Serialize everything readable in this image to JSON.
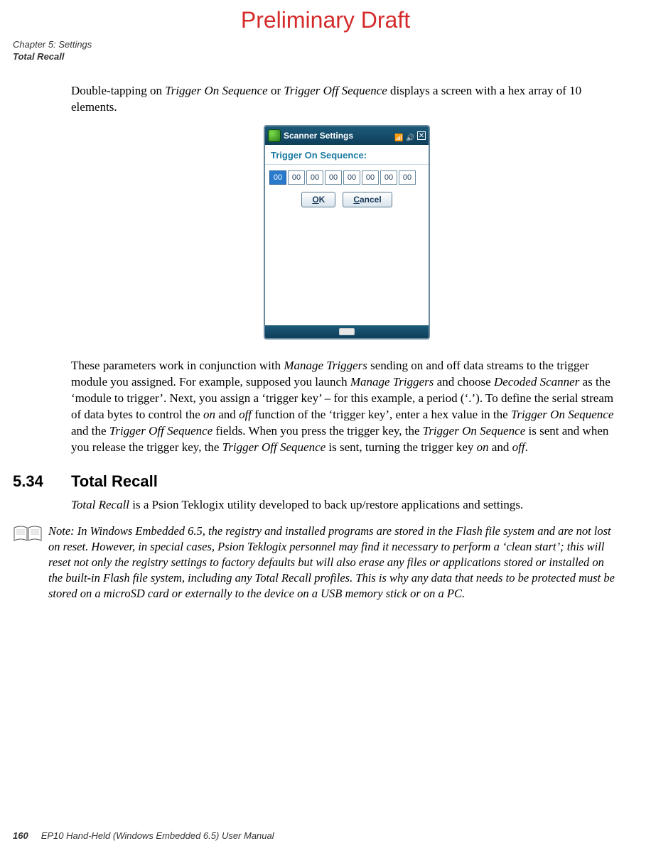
{
  "draft_header": "Preliminary Draft",
  "chapter_line1": "Chapter 5: Settings",
  "chapter_line2": "Total Recall",
  "para1_a": "Double-tapping on ",
  "para1_b": "Trigger On Sequence",
  "para1_c": " or ",
  "para1_d": "Trigger Off Sequence",
  "para1_e": " displays a screen with a hex array of 10 elements.",
  "screenshot": {
    "titlebar": "Scanner Settings",
    "close": "✕",
    "subhead": "Trigger On Sequence:",
    "hex": [
      "00",
      "00",
      "00",
      "00",
      "00",
      "00",
      "00",
      "00"
    ],
    "ok_u": "O",
    "ok_rest": "K",
    "cancel_u": "C",
    "cancel_rest": "ancel"
  },
  "para2_a": "These parameters work in conjunction with ",
  "para2_b": "Manage Triggers",
  "para2_c": " sending on and off data streams to the trigger module you assigned. For example, supposed you launch ",
  "para2_d": "Manage Triggers",
  "para2_e": " and choose ",
  "para2_f": "Decoded Scanner",
  "para2_g": " as the ‘module to trigger’. Next, you assign a ‘trigger key’ – for this example, a period (‘.’). To define the serial stream of data bytes to control the ",
  "para2_h": "on",
  "para2_i": " and ",
  "para2_j": "off",
  "para2_k": " function of the ‘trigger key’, enter a hex value in the ",
  "para2_l": "Trigger On Sequence",
  "para2_m": " and the ",
  "para2_n": "Trigger Off Sequence",
  "para2_o": " fields. When you press the trigger key, the ",
  "para2_p": "Trigger On Sequence",
  "para2_q": " is sent and when you release the trigger key, the ",
  "para2_r": "Trigger Off Sequence",
  "para2_s": " is sent, turning the trigger key ",
  "para2_t": "on",
  "para2_u": " and ",
  "para2_v": "off",
  "para2_w": ".",
  "sec_num": "5.34",
  "sec_title": "Total Recall",
  "para3_a": "Total Recall",
  "para3_b": " is a Psion Teklogix utility developed to back up/restore applications and settings.",
  "note_label": "Note:",
  "note_body": " In Windows Embedded 6.5, the registry and installed programs are stored in the Flash file system and are not lost on reset. However, in special cases, Psion Teklogix personnel may find it necessary to perform a ‘clean start’; this will reset not only the registry settings to factory defaults but will also erase any files or applications stored or installed on the built-in Flash file system, including any Total Recall pro­files. This is why any data that needs to be protected must be stored on a microSD card or externally to the device on a USB memory stick or on a PC.",
  "footer_page": "160",
  "footer_text": "EP10 Hand-Held (Windows Embedded 6.5) User Manual"
}
